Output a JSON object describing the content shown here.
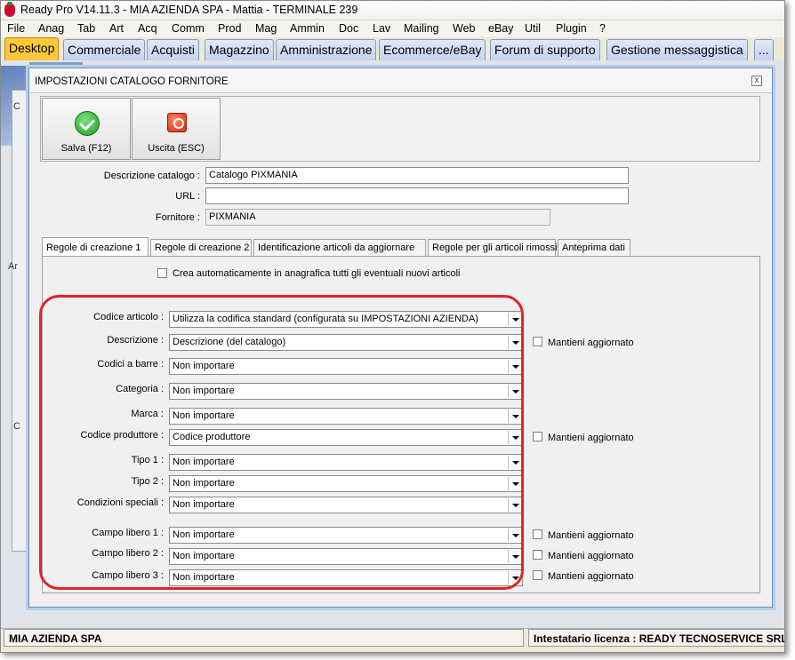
{
  "window": {
    "title": "Ready Pro V14.11.3 - MIA AZIENDA SPA - Mattia - TERMINALE 239"
  },
  "menu": [
    "File",
    "Anag",
    "Tab",
    "Art",
    "Acq",
    "Comm",
    "Prod",
    "Mag",
    "Ammin",
    "Doc",
    "Lav",
    "Mailing",
    "Web",
    "eBay",
    "Util",
    "Plugin",
    "?"
  ],
  "top_tabs": [
    "Desktop",
    "Commerciale",
    "Acquisti",
    "Magazzino",
    "Amministrazione",
    "Ecommerce/eBay",
    "Forum di supporto",
    "Gestione messaggistica",
    "..."
  ],
  "background_letters": {
    "a": "Ar",
    "b": "C",
    "c": "C"
  },
  "dialog": {
    "title": "IMPOSTAZIONI CATALOGO FORNITORE",
    "close_symbol": "x",
    "toolbar": {
      "save": "Salva (F12)",
      "exit": "Uscita (ESC)"
    },
    "fields": {
      "descrizione_label": "Descrizione catalogo :",
      "descrizione_value": "Catalogo PIXMANIA",
      "url_label": "URL :",
      "url_value": "",
      "fornitore_label": "Fornitore :",
      "fornitore_value": "PIXMANIA"
    },
    "tabs": [
      "Regole di creazione 1",
      "Regole di creazione 2",
      "Identificazione articoli da aggiornare",
      "Regole per gli articoli rimossi",
      "Anteprima dati"
    ],
    "auto_create_label": "Crea automaticamente in anagrafica tutti gli eventuali nuovi articoli",
    "keep_updated_label": "Mantieni aggiornato",
    "rules": [
      {
        "label": "Codice articolo :",
        "value": "Utilizza la codifica standard (configurata su IMPOSTAZIONI AZIENDA)",
        "keep": false
      },
      {
        "label": "Descrizione :",
        "value": "Descrizione (del catalogo)",
        "keep": true
      },
      {
        "label": "Codici a barre :",
        "value": "Non importare",
        "keep": false
      },
      {
        "label": "Categoria :",
        "value": "Non importare",
        "keep": false
      },
      {
        "label": "Marca :",
        "value": "Non importare",
        "keep": false
      },
      {
        "label": "Codice produttore :",
        "value": "Codice produttore",
        "keep": true
      },
      {
        "label": "Tipo 1 :",
        "value": "Non importare",
        "keep": false
      },
      {
        "label": "Tipo 2 :",
        "value": "Non importare",
        "keep": false
      },
      {
        "label": "Condizioni speciali :",
        "value": "Non importare",
        "keep": false
      },
      {
        "label": "Campo libero 1 :",
        "value": "Non importare",
        "keep": true
      },
      {
        "label": "Campo libero 2 :",
        "value": "Non importare",
        "keep": true
      },
      {
        "label": "Campo libero 3 :",
        "value": "Non importare",
        "keep": true
      }
    ]
  },
  "status": {
    "left": "MIA AZIENDA SPA",
    "right": "Intestatario licenza : READY TECNOSERVICE SRL"
  }
}
